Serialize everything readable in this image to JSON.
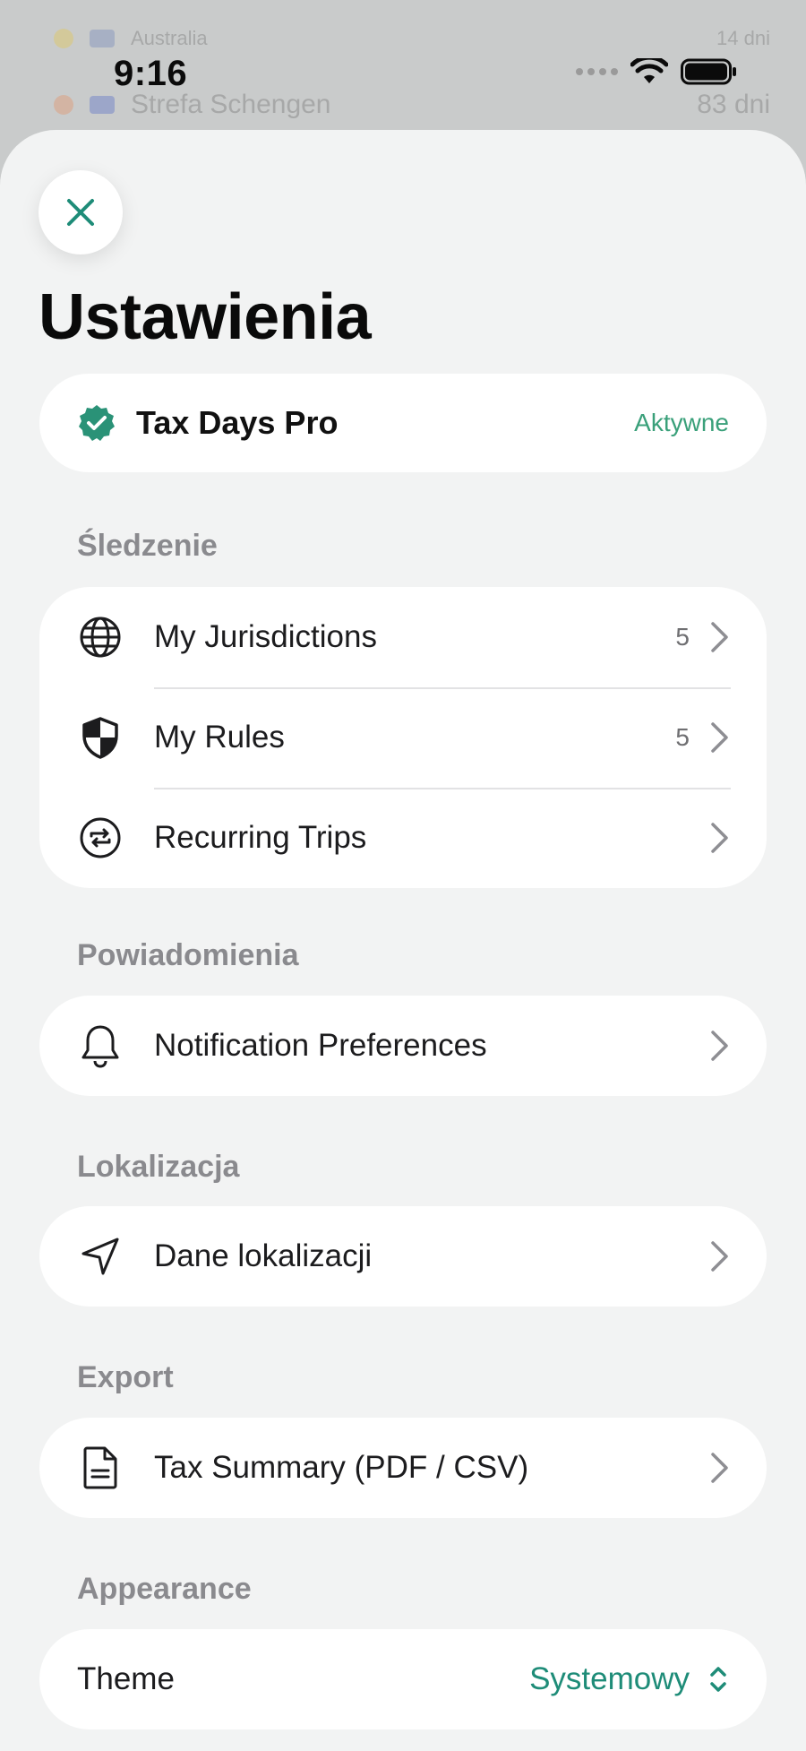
{
  "background": {
    "rows": [
      {
        "name": "Australia",
        "value": "14 dni"
      },
      {
        "name": "Strefa Schengen",
        "value": "83 dni"
      }
    ]
  },
  "status_bar": {
    "time": "9:16"
  },
  "header": {
    "title": "Ustawienia"
  },
  "pro": {
    "label": "Tax Days Pro",
    "status": "Aktywne"
  },
  "sections": {
    "tracking": {
      "header": "Śledzenie",
      "items": [
        {
          "label": "My Jurisdictions",
          "count": "5",
          "icon": "globe-icon"
        },
        {
          "label": "My Rules",
          "count": "5",
          "icon": "shield-icon"
        },
        {
          "label": "Recurring Trips",
          "count": "",
          "icon": "repeat-icon"
        }
      ]
    },
    "notifications": {
      "header": "Powiadomienia",
      "item": "Notification Preferences",
      "icon": "bell-icon"
    },
    "location": {
      "header": "Lokalizacja",
      "item": "Dane lokalizacji",
      "icon": "location-arrow-icon"
    },
    "export": {
      "header": "Export",
      "item": "Tax Summary (PDF / CSV)",
      "icon": "document-icon"
    },
    "appearance": {
      "header": "Appearance",
      "theme_label": "Theme",
      "theme_value": "Systemowy"
    }
  },
  "colors": {
    "accent": "#1e8c78",
    "active": "#3aa07a",
    "sheet_bg": "#f2f3f3"
  }
}
